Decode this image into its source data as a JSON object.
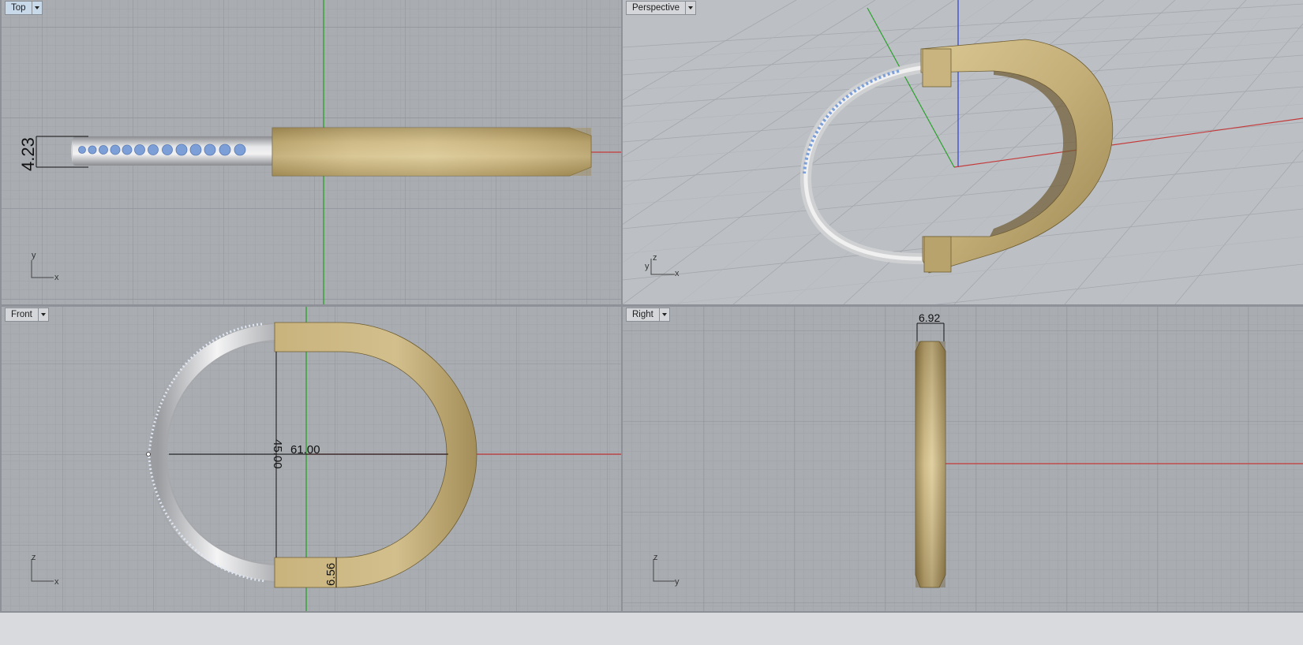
{
  "viewports": {
    "top": {
      "label": "Top",
      "active": true
    },
    "perspective": {
      "label": "Perspective"
    },
    "front": {
      "label": "Front"
    },
    "right": {
      "label": "Right"
    }
  },
  "dimensions": {
    "top_thickness": "4.23",
    "front_height": "45.00",
    "front_width": "61.00",
    "front_end": "6.56",
    "right_width": "6.92"
  },
  "axes": {
    "top": [
      "y",
      "x"
    ],
    "perspective": [
      "z",
      "y",
      "x"
    ],
    "front": [
      "z",
      "x"
    ],
    "right": [
      "z",
      "y"
    ]
  },
  "colors": {
    "grid_bg": "#a9adb2",
    "gold": "#c4b07a",
    "silver": "#d6d7d9",
    "stones": "#7d9fd8",
    "x_axis": "#c43a3a",
    "y_axis": "#2aa02a",
    "z_axis": "#2c3fcf"
  }
}
